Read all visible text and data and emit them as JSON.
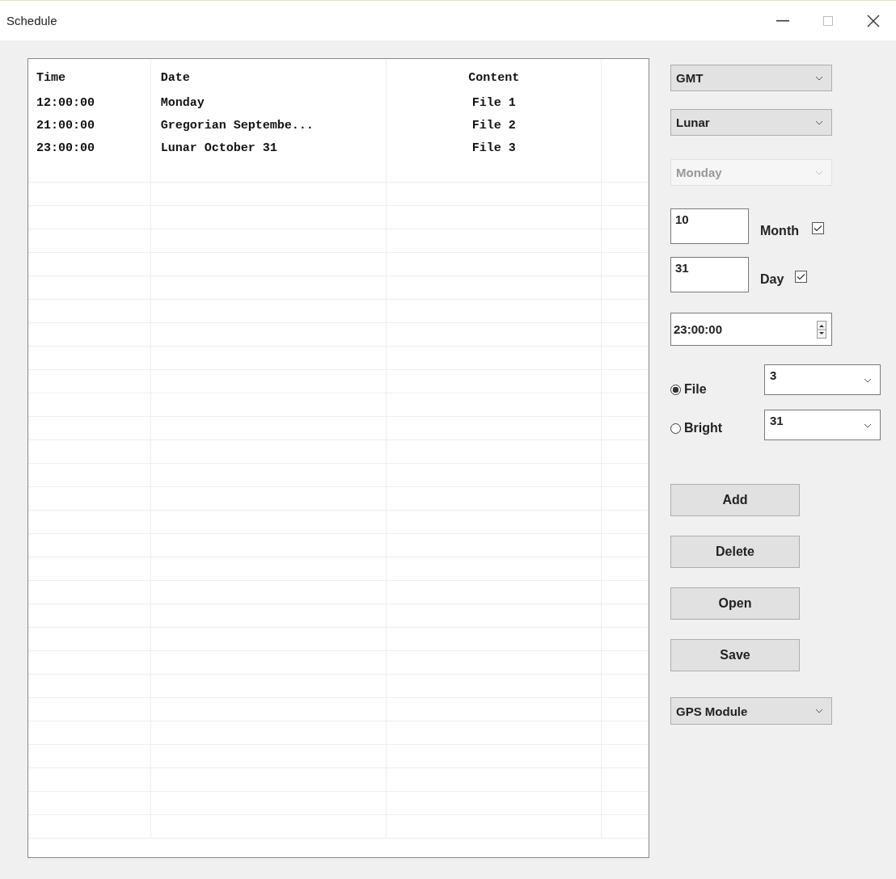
{
  "window": {
    "title": "Schedule"
  },
  "table": {
    "columns": [
      "Time",
      "Date",
      "Content"
    ],
    "rows": [
      {
        "time": "12:00:00",
        "date": "Monday",
        "content": "File 1"
      },
      {
        "time": "21:00:00",
        "date": "Gregorian Septembe...",
        "content": "File 2"
      },
      {
        "time": "23:00:00",
        "date": "Lunar October 31",
        "content": "File 3"
      }
    ]
  },
  "clock_select": {
    "value": "GMT",
    "disabled": false
  },
  "calendar_select": {
    "value": "Lunar",
    "disabled": false
  },
  "weekday_select": {
    "value": "Monday",
    "disabled": true
  },
  "month": {
    "value": "10",
    "label": "Month",
    "checked": true
  },
  "day": {
    "value": "31",
    "label": "Day",
    "checked": true
  },
  "time": {
    "value": "23:00:00"
  },
  "modes": [
    {
      "label": "File",
      "selected": true,
      "value": "3"
    },
    {
      "label": "Bright",
      "selected": false,
      "value": "31"
    }
  ],
  "buttons": [
    "Add",
    "Delete",
    "Open",
    "Save"
  ],
  "module_select": {
    "value": "GPS Module",
    "disabled": false
  }
}
